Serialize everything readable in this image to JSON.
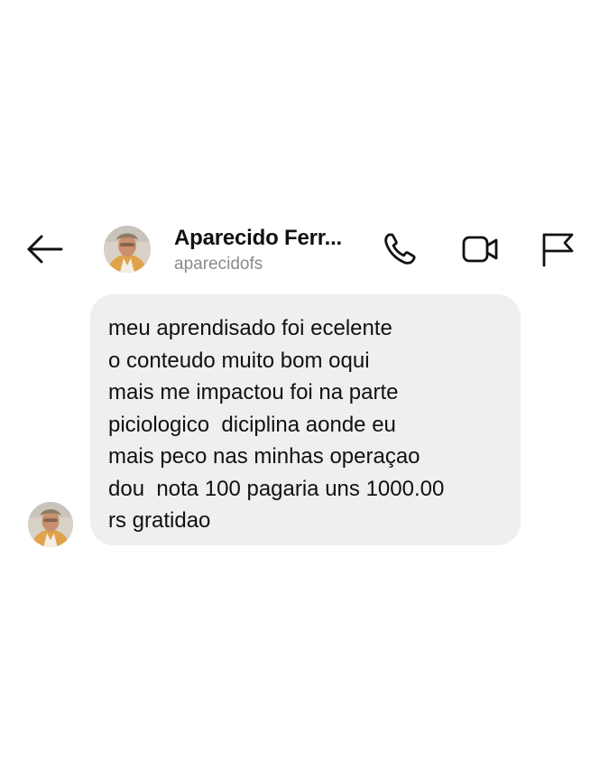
{
  "header": {
    "contact_name": "Aparecido Ferr...",
    "contact_handle": "aparecidofs",
    "icons": {
      "back": "arrow-left-icon",
      "call": "phone-icon",
      "video": "video-camera-icon",
      "report": "flag-icon"
    }
  },
  "message": {
    "lines": [
      "meu aprendisado foi ecelente",
      "o conteudo muito bom oqui",
      "mais me impactou foi na parte",
      "piciologico  diciplina aonde eu",
      "mais peco nas minhas operaçao",
      "dou  nota 100 pagaria uns 1000.00",
      "rs gratidao"
    ]
  },
  "colors": {
    "background": "#ffffff",
    "bubble": "#efeef1",
    "text": "#111111",
    "secondary_text": "#8a8a8a"
  }
}
